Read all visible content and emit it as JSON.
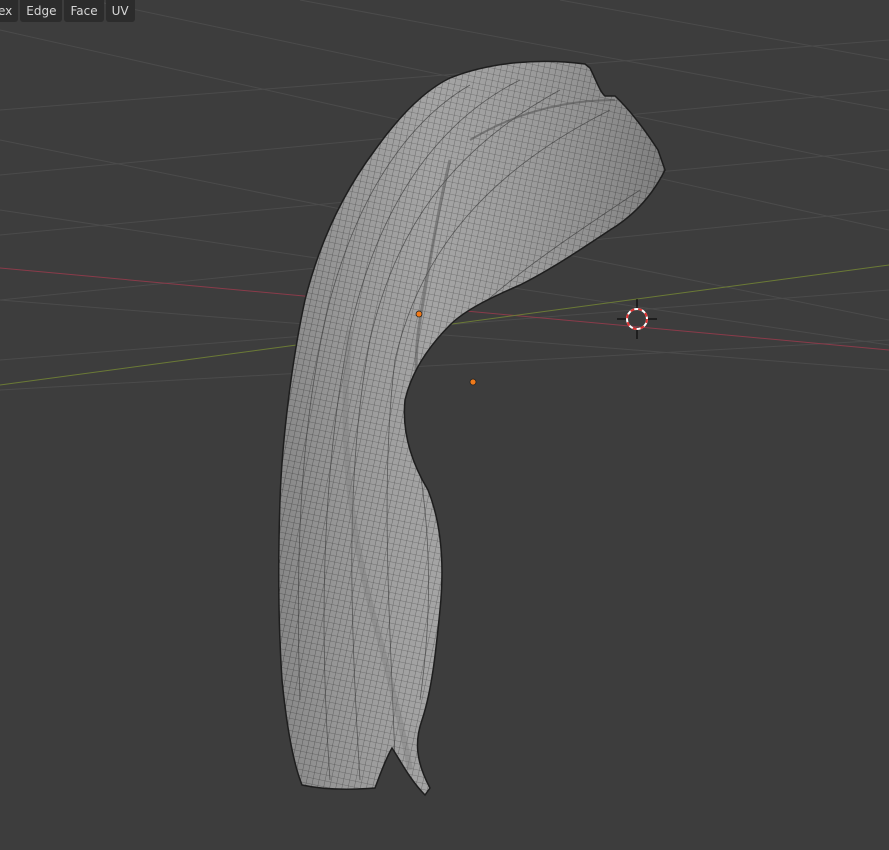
{
  "header_menu": {
    "items": [
      {
        "label": "ex"
      },
      {
        "label": "Edge"
      },
      {
        "label": "Face"
      },
      {
        "label": "UV"
      }
    ]
  },
  "viewport": {
    "background_color": "#3d3d3d",
    "grid_color": "#4a4a4a",
    "x_axis_color": "#8a3b4a",
    "y_axis_color": "#6b7a36",
    "mesh_fill_color": "#9a9a9a",
    "mesh_wire_color": "#2a2a2a",
    "origin_color": "#f07a1a",
    "cursor_icon": "3d-cursor-icon",
    "object": "sculpted-sleeve-mesh"
  }
}
